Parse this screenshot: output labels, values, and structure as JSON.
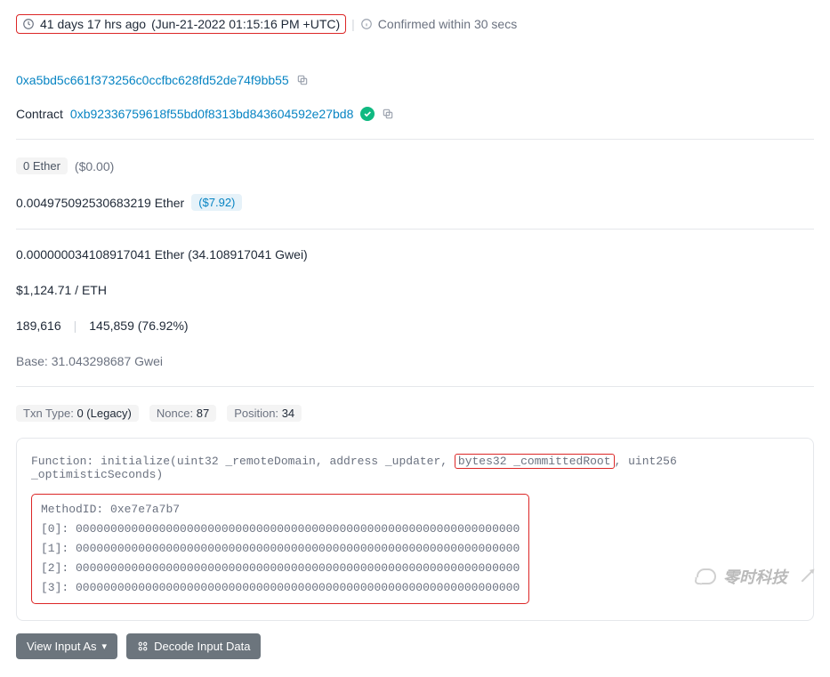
{
  "timestamp": {
    "relative": "41 days 17 hrs ago",
    "absolute": "(Jun-21-2022 01:15:16 PM +UTC)",
    "confirmed": "Confirmed within 30 secs"
  },
  "from_address": "0xa5bd5c661f373256c0ccfbc628fd52de74f9bb55",
  "to_label": "Contract",
  "to_address": "0xb92336759618f55bd0f8313bd843604592e27bd8",
  "value": {
    "amount": "0 Ether",
    "usd": "($0.00)"
  },
  "txn_fee": {
    "ether": "0.004975092530683219 Ether",
    "usd": "($7.92)"
  },
  "gas_price": "0.000000034108917041 Ether (34.108917041 Gwei)",
  "eth_price": "$1,124.71 / ETH",
  "gas_limit": "189,616",
  "gas_used": "145,859 (76.92%)",
  "base_fee": "Base: 31.043298687 Gwei",
  "meta": {
    "txn_type_label": "Txn Type:",
    "txn_type_value": "0 (Legacy)",
    "nonce_label": "Nonce:",
    "nonce_value": "87",
    "position_label": "Position:",
    "position_value": "34"
  },
  "function": {
    "prefix": "Function: initialize(uint32 _remoteDomain, address _updater, ",
    "highlight": "bytes32 _committedRoot",
    "suffix": ", uint256 _optimisticSeconds)"
  },
  "method_id_label": "MethodID:",
  "method_id_value": "0xe7e7a7b7",
  "params": [
    {
      "idx": "[0]:",
      "val": "0000000000000000000000000000000000000000000000000000000000000000"
    },
    {
      "idx": "[1]:",
      "val": "0000000000000000000000000000000000000000000000000000000000000000"
    },
    {
      "idx": "[2]:",
      "val": "0000000000000000000000000000000000000000000000000000000000000000"
    },
    {
      "idx": "[3]:",
      "val": "0000000000000000000000000000000000000000000000000000000000000000"
    }
  ],
  "buttons": {
    "view_input": "View Input As",
    "decode": "Decode Input Data"
  },
  "watermark": "零时科技"
}
